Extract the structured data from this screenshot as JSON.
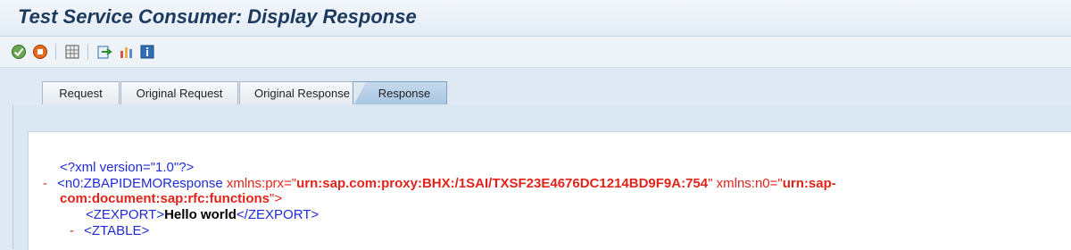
{
  "title": "Test Service Consumer: Display Response",
  "toolbar": {
    "icons": [
      "execute-icon",
      "stop-icon",
      "grid-icon",
      "export-icon",
      "settings-icon",
      "info-icon"
    ]
  },
  "tabs": [
    {
      "label": "Request"
    },
    {
      "label": "Original Request"
    },
    {
      "label": "Original Response"
    },
    {
      "label": "Response",
      "active": true
    }
  ],
  "xml": {
    "declaration": "<?xml version=\"1.0\"?>",
    "minus": "-",
    "line2_open": "<n0:ZBAPIDEMOResponse",
    "line2_attr1": " xmlns:prx=\"",
    "line2_val1": "urn:sap.com:proxy:BHX:/1SAI/TXSF23E4676DC1214BD9F9A:754",
    "line2_attr2": "\" xmlns:n0=\"",
    "line2_val2a": "urn:sap-",
    "line3_val2b": "com:document:sap:rfc:functions",
    "line3_close": "\">",
    "zexport_open": "<ZEXPORT>",
    "zexport_text": "Hello world",
    "zexport_close": "</ZEXPORT>",
    "ztable_open": "<ZTABLE>"
  }
}
